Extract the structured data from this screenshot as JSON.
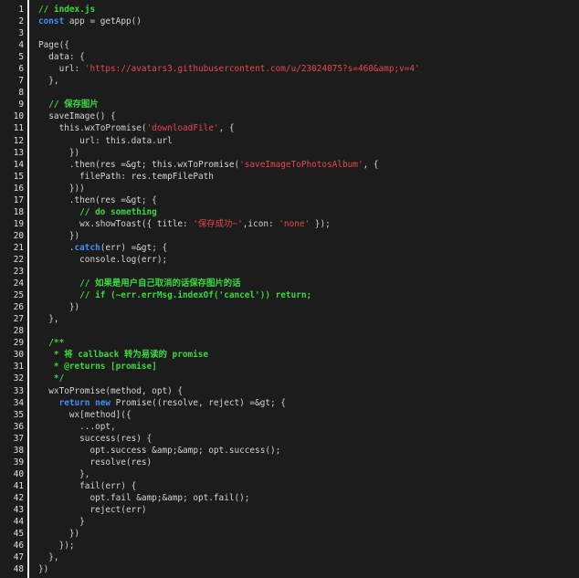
{
  "editor": {
    "colors": {
      "background": "#1c1c1c",
      "gutter_border": "#f0f0f0",
      "line_number": "#e0e0e0",
      "plain": "#d4d4d4",
      "comment": "#39d93f",
      "keyword": "#3f8ff5",
      "string": "#e8474b"
    },
    "lines": [
      {
        "n": "1",
        "tokens": [
          {
            "t": "comment",
            "v": "// index.js"
          }
        ]
      },
      {
        "n": "2",
        "tokens": [
          {
            "t": "keyword",
            "v": "const"
          },
          {
            "t": "plain",
            "v": " app = getApp()"
          }
        ]
      },
      {
        "n": "3",
        "tokens": []
      },
      {
        "n": "4",
        "tokens": [
          {
            "t": "plain",
            "v": "Page({"
          }
        ]
      },
      {
        "n": "5",
        "tokens": [
          {
            "t": "plain",
            "v": "  data: {"
          }
        ]
      },
      {
        "n": "6",
        "tokens": [
          {
            "t": "plain",
            "v": "    url: "
          },
          {
            "t": "string",
            "v": "'https://avatars3.githubusercontent.com/u/23024075?s=460&amp;v=4'"
          }
        ]
      },
      {
        "n": "7",
        "tokens": [
          {
            "t": "plain",
            "v": "  },"
          }
        ]
      },
      {
        "n": "8",
        "tokens": []
      },
      {
        "n": "9",
        "tokens": [
          {
            "t": "comment",
            "v": "  // 保存图片"
          }
        ]
      },
      {
        "n": "10",
        "tokens": [
          {
            "t": "plain",
            "v": "  saveImage() {"
          }
        ]
      },
      {
        "n": "11",
        "tokens": [
          {
            "t": "plain",
            "v": "    this.wxToPromise("
          },
          {
            "t": "string",
            "v": "'downloadFile'"
          },
          {
            "t": "plain",
            "v": ", {"
          }
        ]
      },
      {
        "n": "12",
        "tokens": [
          {
            "t": "plain",
            "v": "        url: this.data.url"
          }
        ]
      },
      {
        "n": "13",
        "tokens": [
          {
            "t": "plain",
            "v": "      })"
          }
        ]
      },
      {
        "n": "14",
        "tokens": [
          {
            "t": "plain",
            "v": "      .then(res =&gt; this.wxToPromise("
          },
          {
            "t": "string",
            "v": "'saveImageToPhotosAlbum'"
          },
          {
            "t": "plain",
            "v": ", {"
          }
        ]
      },
      {
        "n": "15",
        "tokens": [
          {
            "t": "plain",
            "v": "        filePath: res.tempFilePath"
          }
        ]
      },
      {
        "n": "16",
        "tokens": [
          {
            "t": "plain",
            "v": "      }))"
          }
        ]
      },
      {
        "n": "17",
        "tokens": [
          {
            "t": "plain",
            "v": "      .then(res =&gt; {"
          }
        ]
      },
      {
        "n": "18",
        "tokens": [
          {
            "t": "comment",
            "v": "        // do something"
          }
        ]
      },
      {
        "n": "19",
        "tokens": [
          {
            "t": "plain",
            "v": "        wx.showToast({ title: "
          },
          {
            "t": "string",
            "v": "'保存成功~'"
          },
          {
            "t": "plain",
            "v": ",icon: "
          },
          {
            "t": "string",
            "v": "'none'"
          },
          {
            "t": "plain",
            "v": " });"
          }
        ]
      },
      {
        "n": "20",
        "tokens": [
          {
            "t": "plain",
            "v": "      })"
          }
        ]
      },
      {
        "n": "21",
        "tokens": [
          {
            "t": "plain",
            "v": "      ."
          },
          {
            "t": "keyword",
            "v": "catch"
          },
          {
            "t": "plain",
            "v": "(err) =&gt; {"
          }
        ]
      },
      {
        "n": "22",
        "tokens": [
          {
            "t": "plain",
            "v": "        console.log(err);"
          }
        ]
      },
      {
        "n": "23",
        "tokens": []
      },
      {
        "n": "24",
        "tokens": [
          {
            "t": "comment",
            "v": "        // 如果是用户自己取消的话保存图片的话"
          }
        ]
      },
      {
        "n": "25",
        "tokens": [
          {
            "t": "comment",
            "v": "        // if (~err.errMsg.indexOf('cancel')) return;"
          }
        ]
      },
      {
        "n": "26",
        "tokens": [
          {
            "t": "plain",
            "v": "      })"
          }
        ]
      },
      {
        "n": "27",
        "tokens": [
          {
            "t": "plain",
            "v": "  },"
          }
        ]
      },
      {
        "n": "28",
        "tokens": []
      },
      {
        "n": "29",
        "tokens": [
          {
            "t": "comment",
            "v": "  /**"
          }
        ]
      },
      {
        "n": "30",
        "tokens": [
          {
            "t": "comment",
            "v": "   * 将 callback 转为易读的 promise"
          }
        ]
      },
      {
        "n": "31",
        "tokens": [
          {
            "t": "comment",
            "v": "   * @returns [promise]"
          }
        ]
      },
      {
        "n": "32",
        "tokens": [
          {
            "t": "comment",
            "v": "   */"
          }
        ]
      },
      {
        "n": "33",
        "tokens": [
          {
            "t": "plain",
            "v": "  wxToPromise(method, opt) {"
          }
        ]
      },
      {
        "n": "34",
        "tokens": [
          {
            "t": "plain",
            "v": "    "
          },
          {
            "t": "keyword",
            "v": "return new"
          },
          {
            "t": "plain",
            "v": " Promise((resolve, reject) =&gt; {"
          }
        ]
      },
      {
        "n": "35",
        "tokens": [
          {
            "t": "plain",
            "v": "      wx[method]({"
          }
        ]
      },
      {
        "n": "36",
        "tokens": [
          {
            "t": "plain",
            "v": "        ...opt,"
          }
        ]
      },
      {
        "n": "37",
        "tokens": [
          {
            "t": "plain",
            "v": "        success(res) {"
          }
        ]
      },
      {
        "n": "38",
        "tokens": [
          {
            "t": "plain",
            "v": "          opt.success &amp;&amp; opt.success();"
          }
        ]
      },
      {
        "n": "39",
        "tokens": [
          {
            "t": "plain",
            "v": "          resolve(res)"
          }
        ]
      },
      {
        "n": "40",
        "tokens": [
          {
            "t": "plain",
            "v": "        },"
          }
        ]
      },
      {
        "n": "41",
        "tokens": [
          {
            "t": "plain",
            "v": "        fail(err) {"
          }
        ]
      },
      {
        "n": "42",
        "tokens": [
          {
            "t": "plain",
            "v": "          opt.fail &amp;&amp; opt.fail();"
          }
        ]
      },
      {
        "n": "43",
        "tokens": [
          {
            "t": "plain",
            "v": "          reject(err)"
          }
        ]
      },
      {
        "n": "44",
        "tokens": [
          {
            "t": "plain",
            "v": "        }"
          }
        ]
      },
      {
        "n": "45",
        "tokens": [
          {
            "t": "plain",
            "v": "      })"
          }
        ]
      },
      {
        "n": "46",
        "tokens": [
          {
            "t": "plain",
            "v": "    });"
          }
        ]
      },
      {
        "n": "47",
        "tokens": [
          {
            "t": "plain",
            "v": "  },"
          }
        ]
      },
      {
        "n": "48",
        "tokens": [
          {
            "t": "plain",
            "v": "})"
          }
        ]
      }
    ]
  }
}
